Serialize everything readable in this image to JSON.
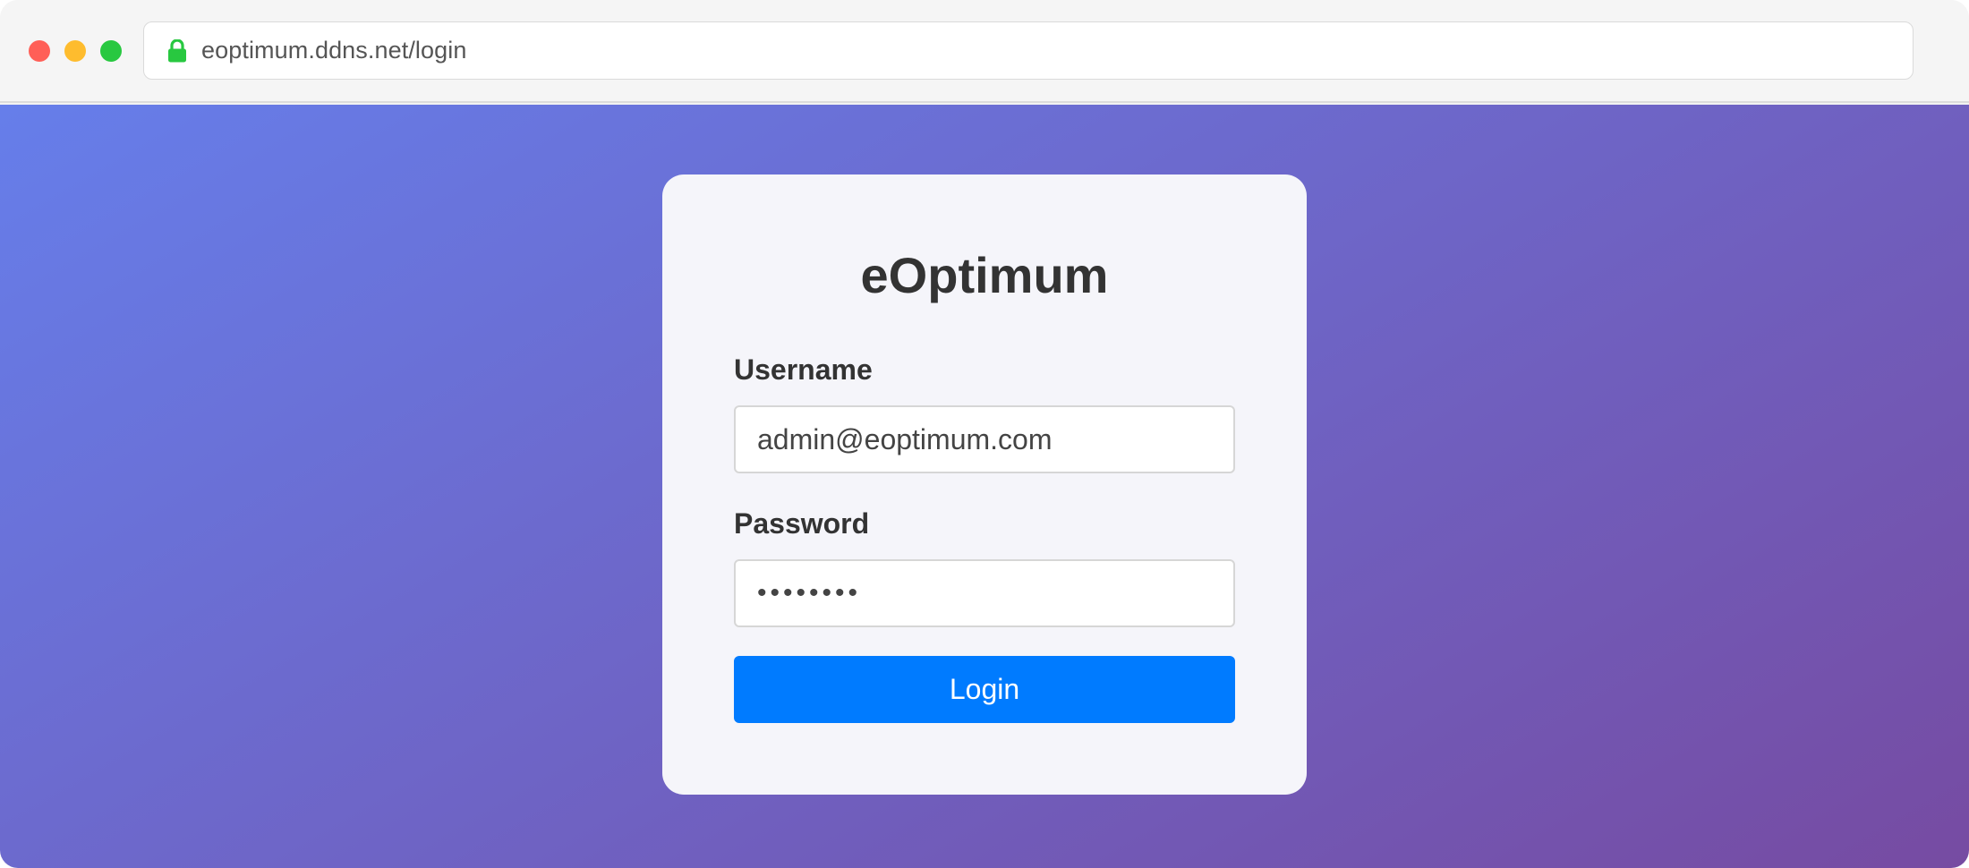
{
  "browser": {
    "url": "eoptimum.ddns.net/login",
    "lock_icon": "lock-icon",
    "lock_color": "#28c840",
    "traffic_lights": [
      "close",
      "minimize",
      "maximize"
    ]
  },
  "login": {
    "title": "eOptimum",
    "username_label": "Username",
    "username_value": "admin@eoptimum.com",
    "password_label": "Password",
    "password_value": "••••••••",
    "login_button": "Login"
  },
  "colors": {
    "gradient_start": "#667eea",
    "gradient_end": "#764ba2",
    "button": "#007bff",
    "card": "#f5f5fa"
  }
}
